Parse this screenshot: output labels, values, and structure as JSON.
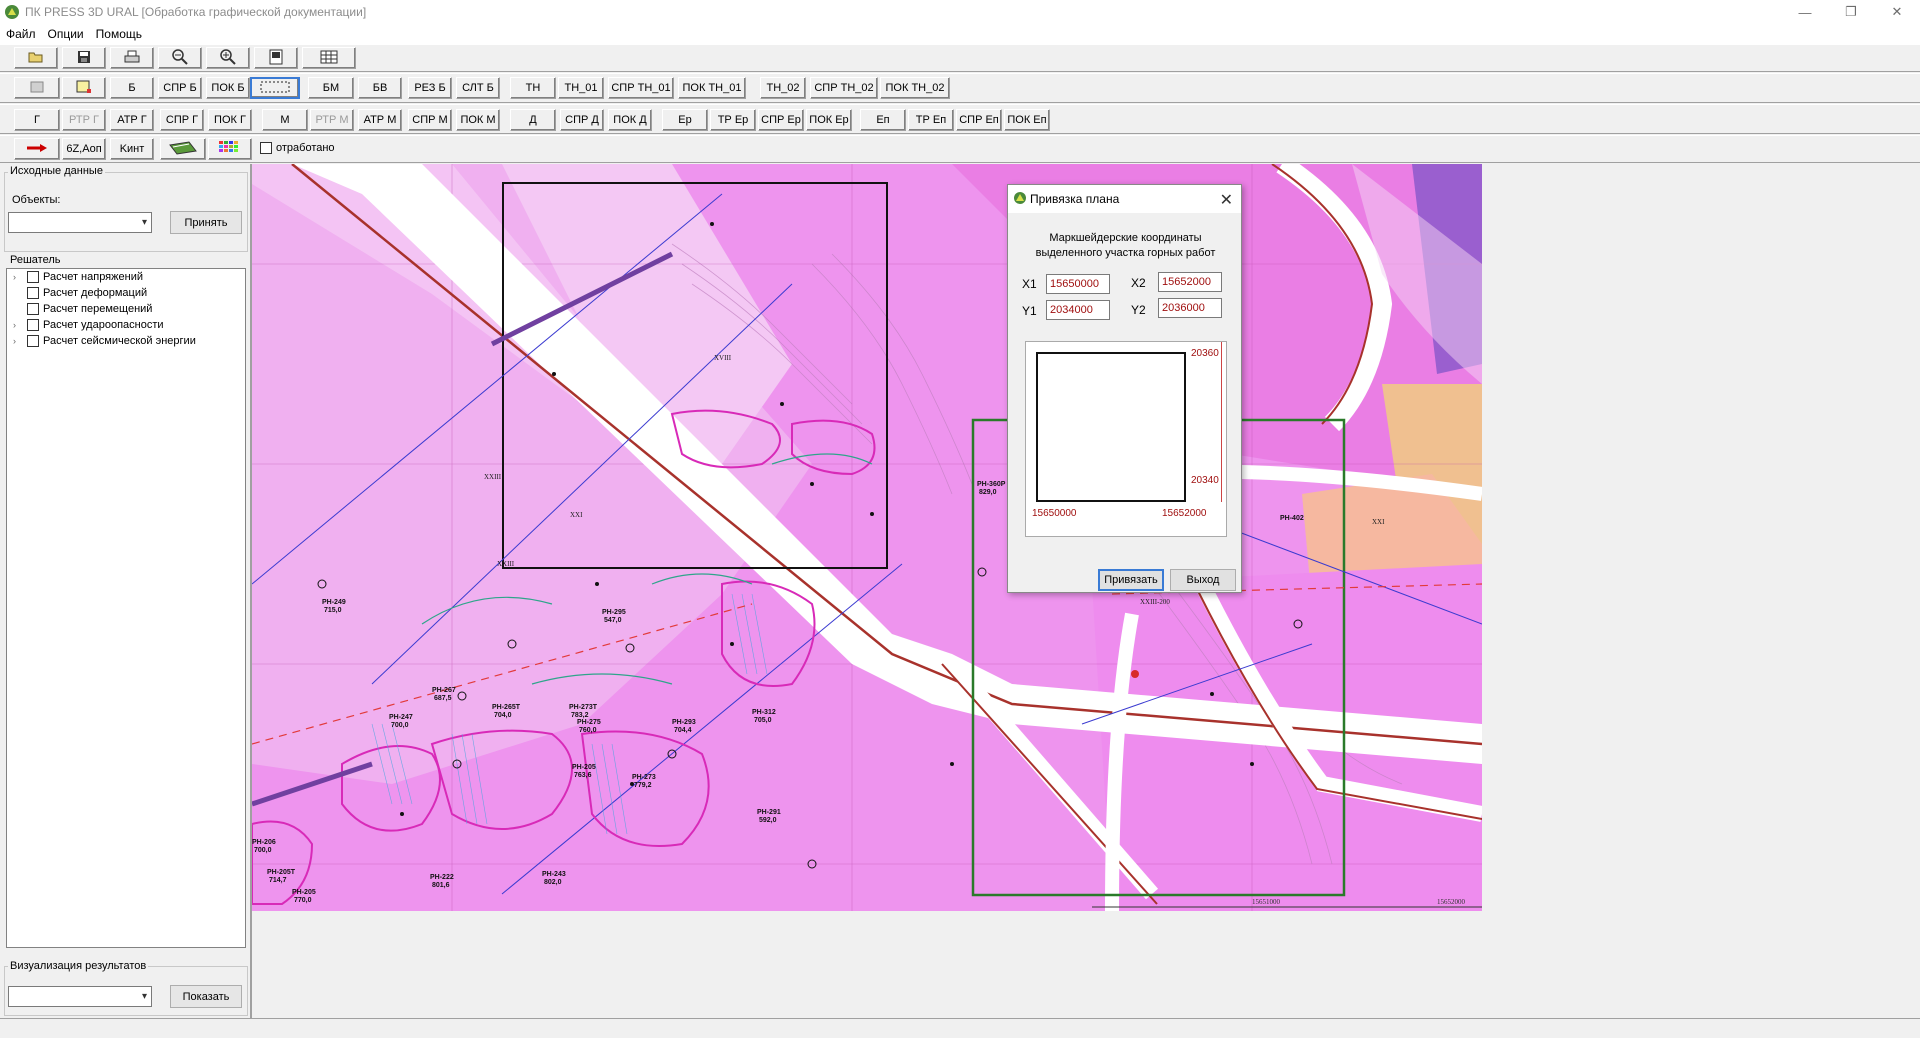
{
  "window": {
    "title": "ПК PRESS 3D URAL [Обработка  графической  документации]",
    "minimize": "—",
    "restore": "❐",
    "close": "✕"
  },
  "menu": [
    "Файл",
    "Опции",
    "Помощь"
  ],
  "toolbar1": {
    "icons": [
      "open-folder-icon",
      "save-icon",
      "print-icon",
      "zoom-out-icon",
      "zoom-in-icon",
      "page-icon",
      "table-icon"
    ]
  },
  "toolbar2": [
    "Б",
    "СПР Б",
    "ПОК Б",
    "БМ",
    "БВ",
    "РЕЗ Б",
    "СЛТ Б",
    "ТН",
    "ТН_01",
    "СПР ТН_01",
    "ПОК ТН_01",
    "ТН_02",
    "СПР ТН_02",
    "ПОК ТН_02"
  ],
  "toolbar3": [
    "Г",
    "РТР Г",
    "АТР Г",
    "СПР Г",
    "ПОК Г",
    "М",
    "РТР М",
    "АТР М",
    "СПР М",
    "ПОК М",
    "Д",
    "СПР Д",
    "ПОК Д",
    "Ер",
    "ТР Ер",
    "СПР Ер",
    "ПОК Ер",
    "Еп",
    "ТР Еп",
    "СПР Еп",
    "ПОК Еп"
  ],
  "toolbar4": {
    "btn_6z": "6Z,Аоп",
    "btn_k": "Kинт",
    "checkbox_label": "отработано"
  },
  "left_panel": {
    "source_group": "Исходные данные",
    "objects_label": "Объекты:",
    "accept_button": "Принять",
    "solver_group": "Решатель",
    "tree": [
      {
        "label": "Расчет напряжений",
        "expandable": true
      },
      {
        "label": "Расчет деформаций",
        "expandable": false
      },
      {
        "label": "Расчет перемещений",
        "expandable": false
      },
      {
        "label": "Расчет удароопасности",
        "expandable": true
      },
      {
        "label": "Расчет сейсмической энергии",
        "expandable": true
      }
    ],
    "viz_group": "Визуализация результатов",
    "show_button": "Показать"
  },
  "map": {
    "labels": [
      {
        "text": "РН-295",
        "sub": "547,0"
      },
      {
        "text": "РН-249",
        "sub": "715,0"
      },
      {
        "text": "РН-267",
        "sub": "687,5"
      },
      {
        "text": "РН-265Т",
        "sub": "704,0"
      },
      {
        "text": "РН-273Т",
        "sub": "783,2"
      },
      {
        "text": "РН-275",
        "sub": "760,0"
      },
      {
        "text": "РН-247",
        "sub": "700,0"
      },
      {
        "text": "РН-293",
        "sub": "704,4"
      },
      {
        "text": "РН-312",
        "sub": "705,0"
      },
      {
        "text": "РН-205",
        "sub": "763,6"
      },
      {
        "text": "РН-273",
        "sub": "779,2"
      },
      {
        "text": "РН-291",
        "sub": "592,0"
      },
      {
        "text": "РН-222",
        "sub": "801,6"
      },
      {
        "text": "РН-243",
        "sub": "802,0"
      },
      {
        "text": "РН-205Т",
        "sub": "714,7"
      },
      {
        "text": "РН-205",
        "sub": "770,0"
      },
      {
        "text": "РН-206",
        "sub": "700,0"
      },
      {
        "text": "РН-360Р",
        "sub": "829,0"
      },
      {
        "text": "РН-402",
        "sub": ""
      }
    ],
    "roman": [
      "XXI",
      "XXIII",
      "XXIII",
      "XVIII",
      "XXII",
      "XXI",
      "XXIII-200"
    ],
    "scale_left": "15651000",
    "scale_right": "15652000"
  },
  "dialog": {
    "title": "Привязка плана",
    "caption_line1": "Маркшейдерские  координаты",
    "caption_line2": "выделенного  участка горных работ",
    "x1_label": "X1",
    "x1_value": "15650000",
    "x2_label": "X2",
    "x2_value": "15652000",
    "y1_label": "Y1",
    "y1_value": "2034000",
    "y2_label": "Y2",
    "y2_value": "2036000",
    "preview": {
      "top_right": "20360",
      "bottom_right": "20340",
      "bottom_left": "15650000",
      "bottom_x_right": "15652000"
    },
    "bind_button": "Привязать",
    "exit_button": "Выход"
  },
  "colors": {
    "map_bg": "#ee90ee",
    "map_light": "#f2b8f2",
    "road": "#ffffff",
    "road_edge": "#a8322c",
    "accent_red": "#a01010"
  }
}
